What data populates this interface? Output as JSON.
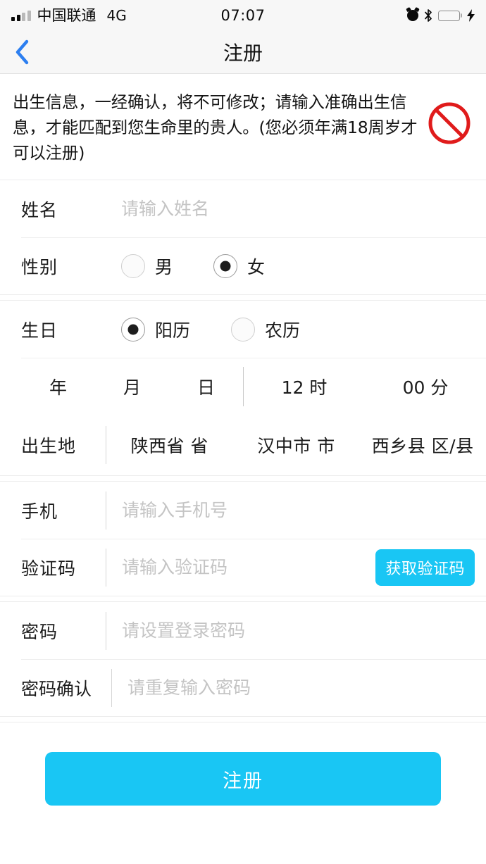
{
  "status_bar": {
    "carrier": "中国联通",
    "network": "4G",
    "time": "07:07",
    "signal_bars_active": 2,
    "signal_bars_total": 4,
    "icons": [
      "alarm-icon",
      "bluetooth-icon",
      "battery-icon",
      "charging-bolt-icon"
    ],
    "battery_color": "#44d62c"
  },
  "navbar": {
    "back_icon": "chevron-left-icon",
    "back_color": "#2d7ff0",
    "title": "注册"
  },
  "notice": {
    "text": "出生信息，一经确认，将不可修改；请输入准确出生信息，才能匹配到您生命里的贵人。(您必须年满18周岁才可以注册)",
    "icon": "no-entry-icon",
    "icon_color": "#e01b1b"
  },
  "form": {
    "name": {
      "label": "姓名",
      "placeholder": "请输入姓名",
      "value": ""
    },
    "gender": {
      "label": "性别",
      "options": [
        {
          "label": "男",
          "selected": false
        },
        {
          "label": "女",
          "selected": true
        }
      ]
    },
    "birthday": {
      "label": "生日",
      "calendar_options": [
        {
          "label": "阳历",
          "selected": true
        },
        {
          "label": "农历",
          "selected": false
        }
      ],
      "date": {
        "year": "年",
        "month": "月",
        "day": "日"
      },
      "time": {
        "hour": "12 时",
        "minute": "00 分"
      }
    },
    "birthplace": {
      "label": "出生地",
      "province": "陕西省 省",
      "city": "汉中市 市",
      "district": "西乡县 区/县"
    },
    "phone": {
      "label": "手机",
      "placeholder": "请输入手机号",
      "value": ""
    },
    "verify_code": {
      "label": "验证码",
      "placeholder": "请输入验证码",
      "value": "",
      "button_label": "获取验证码"
    },
    "password": {
      "label": "密码",
      "placeholder": "请设置登录密码",
      "value": ""
    },
    "password_confirm": {
      "label": "密码确认",
      "placeholder": "请重复输入密码",
      "value": ""
    }
  },
  "submit": {
    "label": "注册",
    "color": "#19c6f4"
  }
}
